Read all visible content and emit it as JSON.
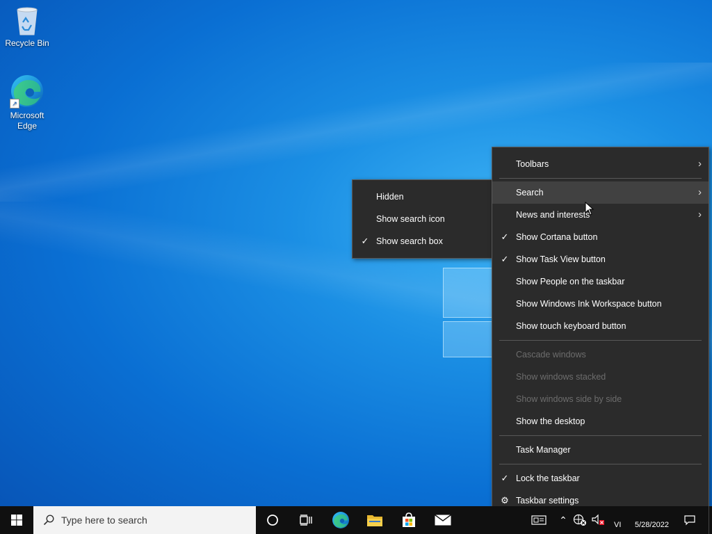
{
  "desktop": {
    "icons": [
      {
        "label": "Recycle Bin"
      },
      {
        "label": "Microsoft Edge"
      }
    ]
  },
  "context_menu": {
    "items": [
      {
        "label": "Toolbars",
        "submenu": true
      },
      {
        "label": "Search",
        "submenu": true,
        "highlighted": true
      },
      {
        "label": "News and interests",
        "submenu": true
      },
      {
        "label": "Show Cortana button",
        "checked": true
      },
      {
        "label": "Show Task View button",
        "checked": true
      },
      {
        "label": "Show People on the taskbar"
      },
      {
        "label": "Show Windows Ink Workspace button"
      },
      {
        "label": "Show touch keyboard button"
      },
      {
        "label": "Cascade windows",
        "disabled": true
      },
      {
        "label": "Show windows stacked",
        "disabled": true
      },
      {
        "label": "Show windows side by side",
        "disabled": true
      },
      {
        "label": "Show the desktop"
      },
      {
        "label": "Task Manager"
      },
      {
        "label": "Lock the taskbar",
        "checked": true
      },
      {
        "label": "Taskbar settings",
        "icon": "gear-icon"
      }
    ]
  },
  "search_submenu": {
    "items": [
      {
        "label": "Hidden"
      },
      {
        "label": "Show search icon"
      },
      {
        "label": "Show search box",
        "checked": true
      }
    ]
  },
  "taskbar": {
    "search_placeholder": "Type here to search",
    "pinned": [
      "cortana-icon",
      "task-view-icon",
      "edge-icon",
      "file-explorer-icon",
      "store-icon",
      "mail-icon"
    ],
    "tray": {
      "language": "VI",
      "date": "5/28/2022"
    }
  },
  "glyphs": {
    "check": "✓",
    "arrow": "›",
    "gear": "⚙",
    "search": "⚲",
    "chevron_up": "⌃"
  }
}
